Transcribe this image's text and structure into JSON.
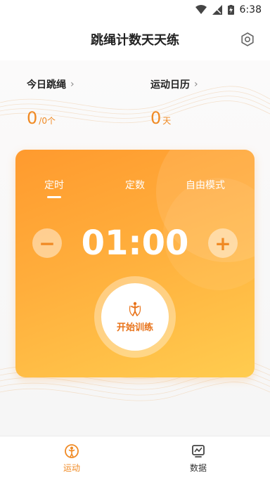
{
  "status_bar": {
    "time": "6:38"
  },
  "app_bar": {
    "title": "跳绳计数天天练"
  },
  "stats": {
    "today": {
      "label": "今日跳绳",
      "value": "0",
      "unit": "/0个"
    },
    "calendar": {
      "label": "运动日历",
      "value": "0",
      "unit": "天"
    }
  },
  "card": {
    "tabs": [
      {
        "label": "定时",
        "active": true
      },
      {
        "label": "定数",
        "active": false
      },
      {
        "label": "自由模式",
        "active": false
      }
    ],
    "timer": "01:00",
    "minus_label": "−",
    "plus_label": "+",
    "start_label": "开始训练"
  },
  "bottom_nav": [
    {
      "label": "运动",
      "active": true
    },
    {
      "label": "数据",
      "active": false
    }
  ],
  "colors": {
    "accent": "#f08a24",
    "card_start": "#ff9a2e",
    "card_end": "#ffcc4f"
  }
}
